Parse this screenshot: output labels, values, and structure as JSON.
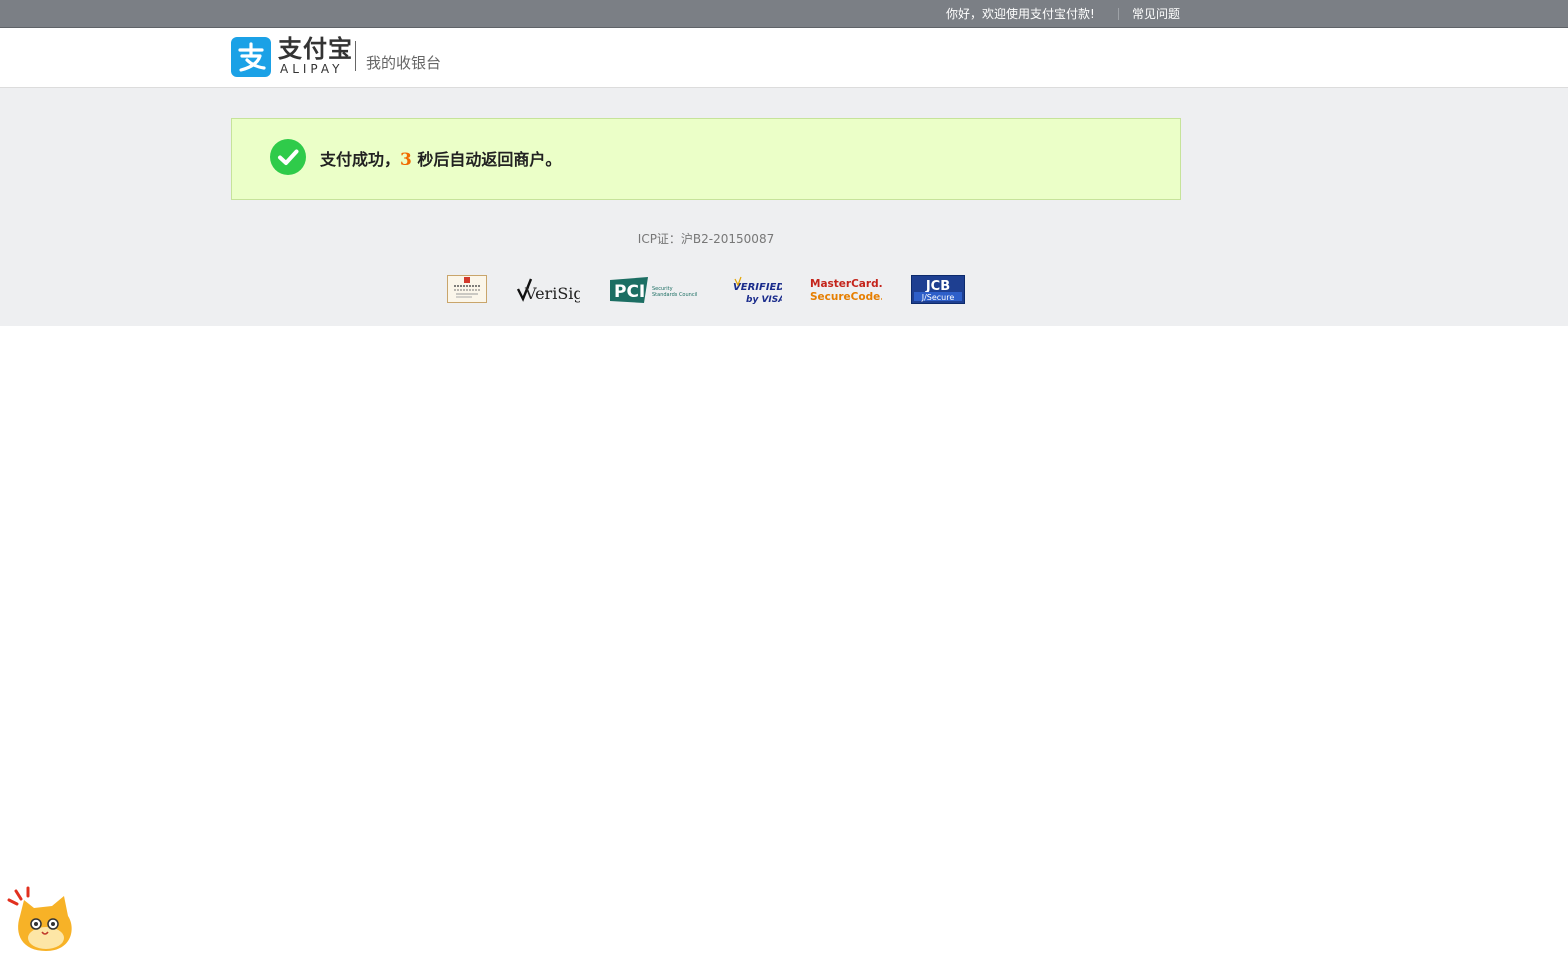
{
  "topbar": {
    "welcome": "你好，欢迎使用支付宝付款!",
    "faq": "常见问题"
  },
  "header": {
    "logo_cn": "支付宝",
    "logo_en": "ALIPAY",
    "cashier": "我的收银台"
  },
  "success": {
    "prefix": "支付成功，",
    "countdown": "3",
    "suffix": " 秒后自动返回商户。"
  },
  "footer": {
    "icp": "ICP证：沪B2-20150087",
    "certs": [
      {
        "name": "cert-seal",
        "label": ""
      },
      {
        "name": "verisign",
        "label": "VeriSign"
      },
      {
        "name": "pci",
        "label": "PCI",
        "sub": "Security Standards Council"
      },
      {
        "name": "verified-by-visa",
        "label": "VERIFIED",
        "sub": "by VISA"
      },
      {
        "name": "mastercard-securecode",
        "label": "MasterCard.",
        "sub": "SecureCode."
      },
      {
        "name": "jcb",
        "label": "JCB",
        "sub": "J/Secure"
      }
    ]
  },
  "colors": {
    "topbar": "#7b7f85",
    "alipay_blue": "#1ba1e6",
    "success_bg": "#ebffc8",
    "check_green": "#2fcb4a",
    "countdown": "#f16a00",
    "main_bg": "#eeeff1"
  }
}
